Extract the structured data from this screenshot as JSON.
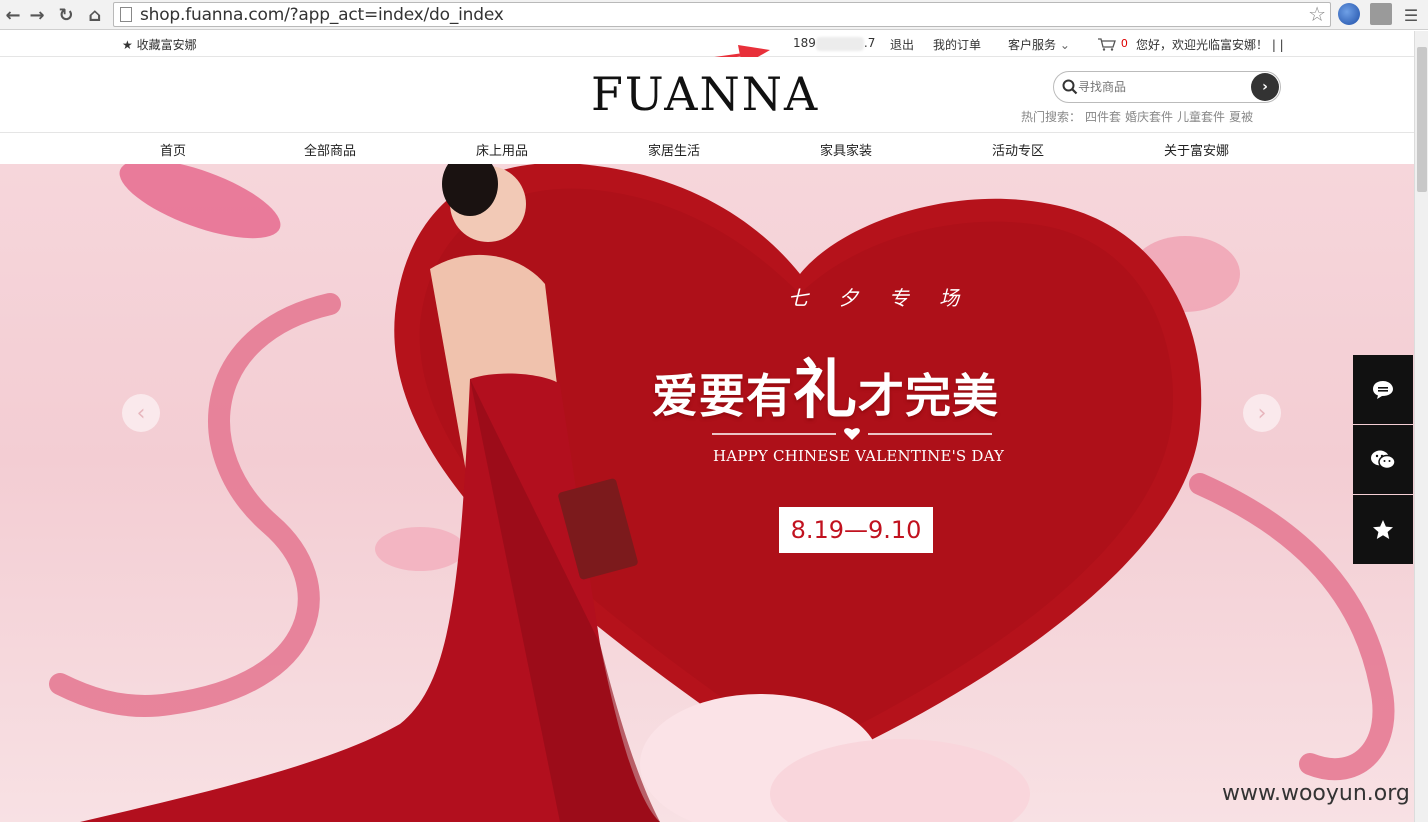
{
  "browser": {
    "url": "shop.fuanna.com/?app_act=index/do_index",
    "icons": [
      "back-arrow-icon",
      "forward-arrow-icon",
      "reload-icon",
      "home-icon",
      "page-icon",
      "bookmark-star-icon",
      "globe-icon",
      "extension-icon",
      "menu-icon"
    ]
  },
  "topbar": {
    "favorite_label": "收藏富安娜",
    "phone_prefix": "189",
    "phone_suffix": ".7",
    "logout": "退出",
    "my_orders": "我的订单",
    "customer_service": "客户服务",
    "cart_count": "0",
    "welcome": "您好，欢迎光临富安娜！ | |"
  },
  "header": {
    "logo": "FUANNA",
    "search_placeholder": "寻找商品",
    "hot_label": "热门搜索：",
    "hot_terms": [
      "四件套",
      "婚庆套件",
      "儿童套件",
      "夏被"
    ]
  },
  "nav": {
    "items": [
      "首页",
      "全部商品",
      "床上用品",
      "家居生活",
      "家具家装",
      "活动专区",
      "关于富安娜"
    ]
  },
  "banner": {
    "subtitle": "七 夕 专 场",
    "title_part1": "爱要有",
    "title_big": "礼",
    "title_part2": "才完美",
    "english": "HAPPY CHINESE VALENTINE'S DAY",
    "date_range": "8.19—9.10",
    "colors": {
      "heart": "#b5121b",
      "ribbon": "#e57a93",
      "background": "#f4d0d6"
    }
  },
  "watermark": "www.wooyun.org"
}
